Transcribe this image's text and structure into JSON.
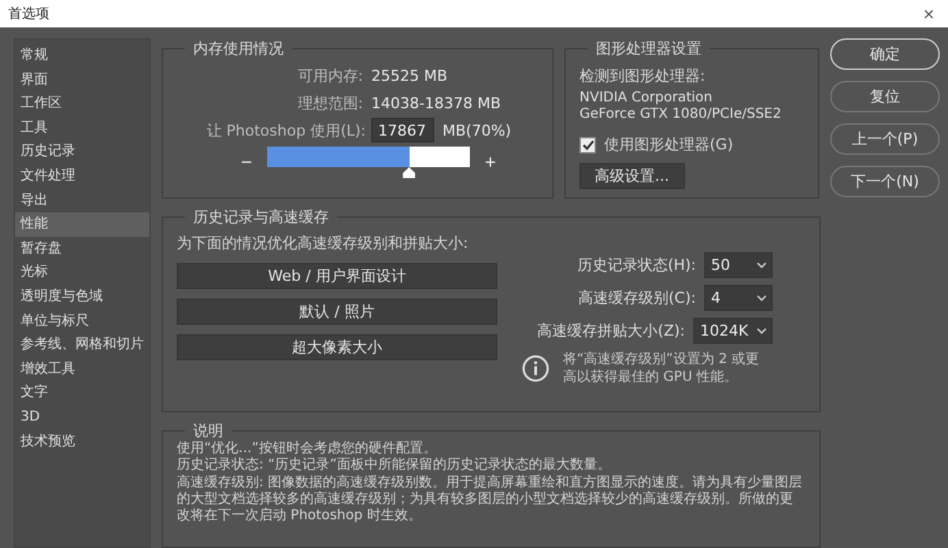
{
  "window": {
    "title": "首选项",
    "close": "×"
  },
  "sidebar": {
    "items": [
      {
        "label": "常规",
        "selected": false
      },
      {
        "label": "界面",
        "selected": false
      },
      {
        "label": "工作区",
        "selected": false
      },
      {
        "label": "工具",
        "selected": false
      },
      {
        "label": "历史记录",
        "selected": false
      },
      {
        "label": "文件处理",
        "selected": false
      },
      {
        "label": "导出",
        "selected": false
      },
      {
        "label": "性能",
        "selected": true
      },
      {
        "label": "暂存盘",
        "selected": false
      },
      {
        "label": "光标",
        "selected": false
      },
      {
        "label": "透明度与色域",
        "selected": false
      },
      {
        "label": "单位与标尺",
        "selected": false
      },
      {
        "label": "参考线、网格和切片",
        "selected": false
      },
      {
        "label": "增效工具",
        "selected": false
      },
      {
        "label": "文字",
        "selected": false
      },
      {
        "label": "3D",
        "selected": false
      },
      {
        "label": "技术预览",
        "selected": false
      }
    ]
  },
  "memory": {
    "title": "内存使用情况",
    "rows": [
      {
        "label": "可用内存:",
        "value": "25525 MB"
      },
      {
        "label": "理想范围:",
        "value": "14038-18378 MB"
      }
    ],
    "use_label": "让 Photoshop 使用(L):",
    "use_value": "17867",
    "use_suffix": "MB(70%)",
    "minus": "−",
    "plus": "+",
    "level": 0.7
  },
  "gpu": {
    "title": "图形处理器设置",
    "detected": "检测到图形处理器:",
    "vendor": "NVIDIA Corporation",
    "model": "GeForce GTX 1080/PCIe/SSE2",
    "use_gpu": {
      "label": "使用图形处理器(G)",
      "checked": true
    },
    "advanced": "高级设置..."
  },
  "buttons": [
    {
      "label": "确定",
      "primary": true
    },
    {
      "label": "复位",
      "primary": false
    },
    {
      "label": "上一个(P)",
      "primary": false
    },
    {
      "label": "下一个(N)",
      "primary": false
    }
  ],
  "history": {
    "title": "历史记录与高速缓存",
    "optimize_label": "为下面的情况优化高速缓存级别和拼贴大小:",
    "presets": [
      "Web / 用户界面设计",
      "默认 / 照片",
      "超大像素大小"
    ],
    "fields": [
      {
        "label": "历史记录状态(H):",
        "value": "50"
      },
      {
        "label": "高速缓存级别(C):",
        "value": "4"
      },
      {
        "label": "高速缓存拼贴大小(Z):",
        "value": "1024K"
      }
    ],
    "info": "将“高速缓存级别”设置为 2 或更高以获得最佳的 GPU 性能。"
  },
  "description": {
    "title": "说明",
    "paragraphs": [
      "使用“优化...”按钮时会考虑您的硬件配置。",
      "历史记录状态: “历史记录”面板中所能保留的历史记录状态的最大数量。",
      "高速缓存级别: 图像数据的高速缓存级别数。用于提高屏幕重绘和直方图显示的速度。请为具有少量图层的大型文档选择较多的高速缓存级别；为具有较多图层的小型文档选择较少的高速缓存级别。所做的更改将在下一次启动 Photoshop 时生效。"
    ]
  }
}
